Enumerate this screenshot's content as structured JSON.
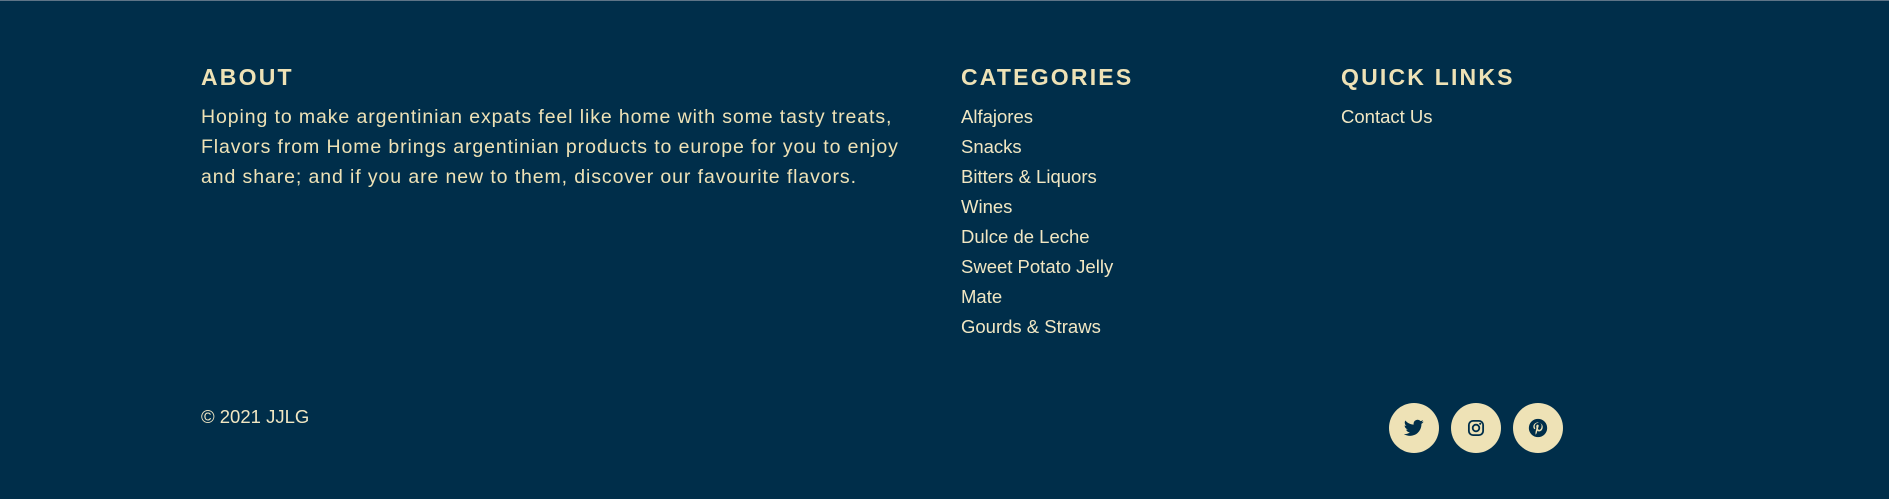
{
  "about": {
    "heading": "ABOUT",
    "text": "Hoping to make argentinian expats feel like home with some tasty treats, Flavors from Home brings argentinian products to europe for you to enjoy and share; and if you are new to them, discover our favourite flavors."
  },
  "categories": {
    "heading": "CATEGORIES",
    "items": [
      "Alfajores",
      "Snacks",
      "Bitters & Liquors",
      "Wines",
      "Dulce de Leche",
      "Sweet Potato Jelly",
      "Mate",
      "Gourds & Straws"
    ]
  },
  "quick_links": {
    "heading": "QUICK LINKS",
    "items": [
      "Contact Us"
    ]
  },
  "copyright": "© 2021 JJLG",
  "social": [
    {
      "icon": "twitter-icon"
    },
    {
      "icon": "instagram-icon"
    },
    {
      "icon": "pinterest-icon"
    }
  ],
  "colors": {
    "background": "#002e4a",
    "text": "#eee2b6",
    "icon_bg": "#eee2b6",
    "icon_fg": "#002e4a"
  }
}
